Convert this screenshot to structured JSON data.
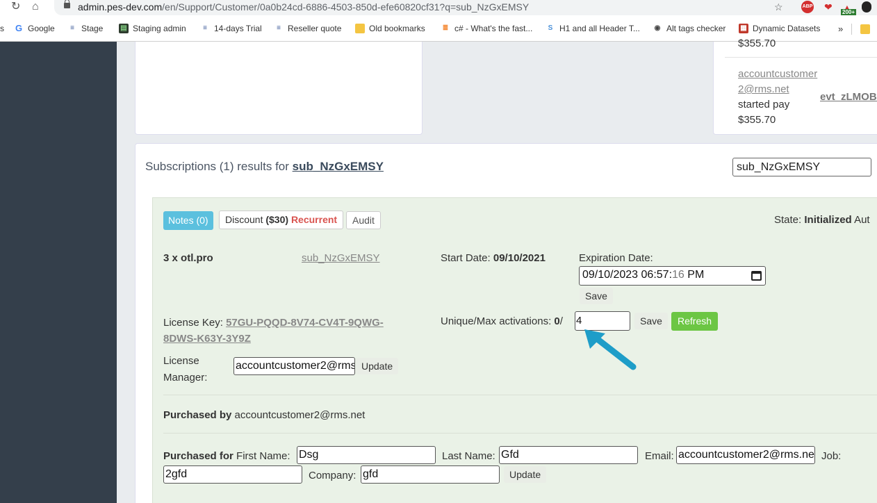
{
  "browser": {
    "url_domain": "admin.pes-dev.com",
    "url_path": "/en/Support/Customer/0a0b24cd-6886-4503-850d-efe60820cf31?q=sub_NzGxEMSY",
    "ext_badge": "200+",
    "bookmarks": [
      {
        "label": "Google",
        "icon": "G",
        "color": "#4285f4"
      },
      {
        "label": "Stage",
        "icon": "≡",
        "color": "#3b5998"
      },
      {
        "label": "Staging admin",
        "icon": "▤",
        "color": "#2d3b2d"
      },
      {
        "label": "14-days Trial",
        "icon": "≡",
        "color": "#3b5998"
      },
      {
        "label": "Reseller quote",
        "icon": "≡",
        "color": "#3b5998"
      },
      {
        "label": "Old bookmarks",
        "icon": "",
        "color": "#f4c542"
      },
      {
        "label": "c# - What's the fast...",
        "icon": "≣",
        "color": "#f48024"
      },
      {
        "label": "H1 and all Header T...",
        "icon": "S",
        "color": "#4a90d9"
      },
      {
        "label": "Alt tags checker",
        "icon": "◉",
        "color": "#444"
      },
      {
        "label": "Dynamic Datasets",
        "icon": "▦",
        "color": "#c0392b"
      }
    ],
    "more": "»"
  },
  "top_right_card": {
    "price_top": "$355.70",
    "email": "accountcustomer2@rms.net",
    "action": "started pay",
    "price": "$355.70",
    "event": "evt_zLMOBS"
  },
  "subscriptions": {
    "title_prefix": "Subscriptions (1) results for",
    "query": "sub_NzGxEMSY",
    "search_value": "sub_NzGxEMSY"
  },
  "subscription": {
    "notes_btn": "Notes (0)",
    "discount_label": "Discount",
    "discount_amount": "($30)",
    "discount_type": "Recurrent",
    "audit_btn": "Audit",
    "state_label": "State:",
    "state_value": "Initialized",
    "state_suffix": "Aut",
    "qty_prefix": "3 x",
    "product": "otl.pro",
    "sub_id": "sub_NzGxEMSY",
    "start_label": "Start Date:",
    "start_value": "09/10/2021",
    "exp_label": "Expiration Date:",
    "exp_value": "09/10/2023 06:57:",
    "exp_seconds": "16",
    "exp_ampm": "PM",
    "save_label": "Save",
    "license_key_label": "License Key:",
    "license_key_line1": "57GU-PQQD-8V74-CV4T-9QWG-",
    "license_key_line2": "8DWS-K63Y-3Y9Z",
    "activations_label": "Unique/Max activations:",
    "activations_unique": "0",
    "activations_sep": "/",
    "activations_max": "4",
    "refresh_label": "Refresh",
    "lic_manager_label1": "License",
    "lic_manager_label2": "Manager:",
    "lic_manager_value": "accountcustomer2@rms",
    "update_label": "Update",
    "purchased_by_label": "Purchased by",
    "purchased_by_value": "accountcustomer2@rms.net",
    "purchased_for_label": "Purchased for",
    "first_name_label": "First Name:",
    "first_name_value": "Dsg",
    "last_name_label": "Last Name:",
    "last_name_value": "Gfd",
    "email_label": "Email:",
    "email_value": "accountcustomer2@rms.ne",
    "job_label": "Job:",
    "job_value": "2gfd",
    "company_label": "Company:",
    "company_value": "gfd"
  },
  "colors": {
    "sidebar": "#343f4b",
    "notes": "#5bc0de",
    "refresh": "#6cc644",
    "recurrent": "#d9534f",
    "arrow": "#1e9dc8"
  }
}
